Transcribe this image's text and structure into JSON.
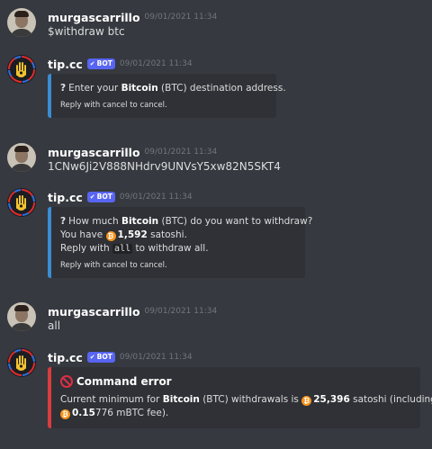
{
  "messages": [
    {
      "username": "murgascarrillo",
      "timestamp": "09/01/2021 11:34",
      "content": "$withdraw btc"
    },
    {
      "username": "tip.cc",
      "bot_tag": "BOT",
      "timestamp": "09/01/2021 11:34",
      "embed": {
        "q_icon": "?",
        "pre": "Enter your ",
        "bold": "Bitcoin",
        "post": " (BTC) destination address.",
        "footer": "Reply with cancel to cancel."
      }
    },
    {
      "username": "murgascarrillo",
      "timestamp": "09/01/2021 11:34",
      "content": "1CNw6Ji2V888NHdrv9UNVsY5xw82N5SKT4"
    },
    {
      "username": "tip.cc",
      "bot_tag": "BOT",
      "timestamp": "09/01/2021 11:34",
      "embed": {
        "q_icon": "?",
        "pre": "How much ",
        "bold": "Bitcoin",
        "post": " (BTC) do you want to withdraw?",
        "have_pre": "You have ",
        "coin": "₿",
        "amount": "1,592",
        "have_post": " satoshi.",
        "reply_pre": "Reply with ",
        "reply_code": "all",
        "reply_post": " to withdraw all.",
        "footer": "Reply with cancel to cancel."
      }
    },
    {
      "username": "murgascarrillo",
      "timestamp": "09/01/2021 11:34",
      "content": "all"
    },
    {
      "username": "tip.cc",
      "bot_tag": "BOT",
      "timestamp": "09/01/2021 11:34",
      "embed": {
        "title": "Command error",
        "pre": "Current minimum for ",
        "bold": "Bitcoin",
        "mid": " (BTC) withdrawals is ",
        "coin": "₿",
        "amount": "25,396",
        "post": " satoshi (including",
        "coin2": "₿",
        "fee_bold": "0.15",
        "fee_rest": "776 mBTC fee)."
      }
    }
  ],
  "colors": {
    "background": "#36393f",
    "embed_blue": "#3a8dd4",
    "embed_red": "#d83c3e",
    "bot_tag": "#5865f2",
    "bitcoin": "#f7931a"
  },
  "icons": {
    "bot_avatar": "tip-cc-hand-logo",
    "user_avatar": "user-photo",
    "question": "question-mark-icon",
    "error": "no-entry-icon",
    "coin": "bitcoin-coin-icon",
    "verified": "check-icon"
  }
}
